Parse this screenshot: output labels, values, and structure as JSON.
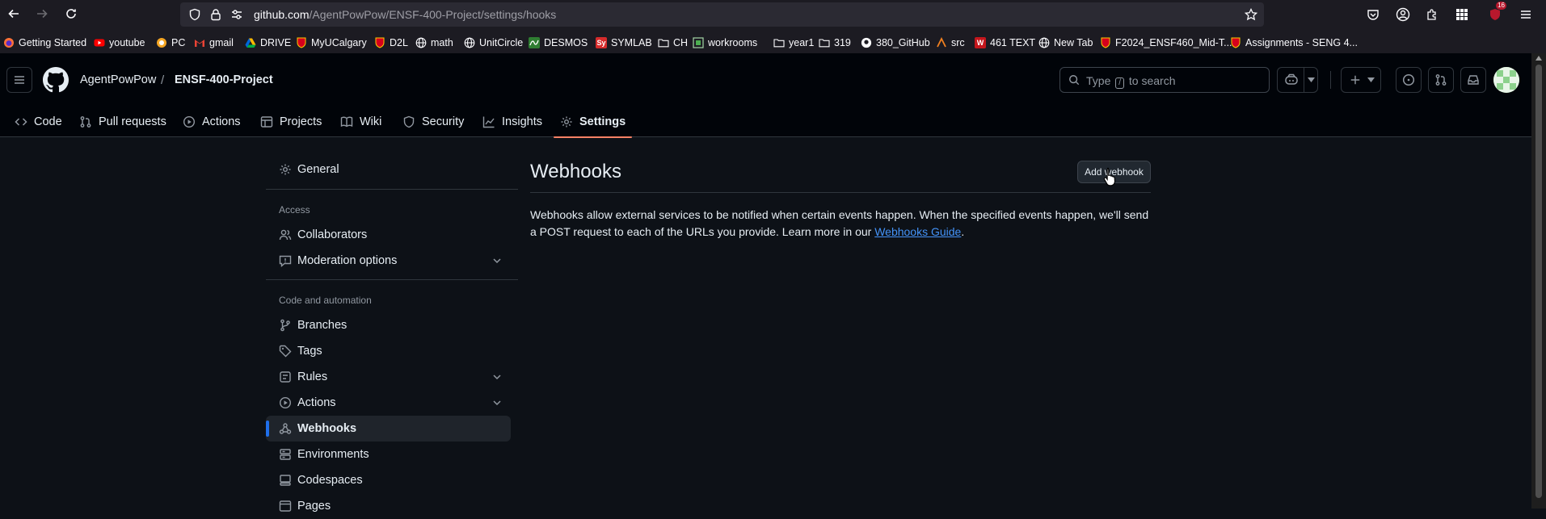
{
  "browser": {
    "url_host": "github.com",
    "url_path": "/AgentPowPow/ENSF-400-Project/settings/hooks",
    "extension_badge": "16",
    "bookmarks": [
      {
        "label": "Getting Started",
        "icon": "firefox-icon",
        "color": "#e66000"
      },
      {
        "label": "youtube",
        "icon": "youtube-icon",
        "color": "#ff0000"
      },
      {
        "label": "PC",
        "icon": "pc-icon",
        "color": "#f5a623"
      },
      {
        "label": "gmail",
        "icon": "gmail-icon",
        "color": "#ea4335"
      },
      {
        "label": "DRIVE",
        "icon": "drive-icon",
        "color": "#1fa463"
      },
      {
        "label": "MyUCalgary",
        "icon": "ucalgary-icon",
        "color": "#d6001c"
      },
      {
        "label": "D2L",
        "icon": "ucalgary-icon",
        "color": "#d6001c"
      },
      {
        "label": "math",
        "icon": "globe-icon",
        "color": "#fbfbfe"
      },
      {
        "label": "UnitCircle",
        "icon": "globe-icon",
        "color": "#fbfbfe"
      },
      {
        "label": "DESMOS",
        "icon": "desmos-icon",
        "color": "#2f7d32"
      },
      {
        "label": "SYMLAB",
        "icon": "symbolab-icon",
        "color": "#d62b2b"
      },
      {
        "label": "CH",
        "icon": "folder-icon",
        "color": "#fbfbfe"
      },
      {
        "label": "workrooms",
        "icon": "workrooms-icon",
        "color": "#4caf50"
      },
      {
        "label": "year1",
        "icon": "folder-icon",
        "color": "#fbfbfe"
      },
      {
        "label": "319",
        "icon": "folder-icon",
        "color": "#fbfbfe"
      },
      {
        "label": "380_GitHub",
        "icon": "github-icon",
        "color": "#fbfbfe"
      },
      {
        "label": "src",
        "icon": "src-icon",
        "color": "#f38020"
      },
      {
        "label": "461 TEXT",
        "icon": "w-icon",
        "color": "#c4161c"
      },
      {
        "label": "New Tab",
        "icon": "globe-icon",
        "color": "#fbfbfe"
      },
      {
        "label": "F2024_ENSF460_Mid-T...",
        "icon": "ucalgary-icon",
        "color": "#d6001c"
      },
      {
        "label": "Assignments - SENG 4...",
        "icon": "ucalgary-icon",
        "color": "#d6001c"
      }
    ]
  },
  "repo": {
    "owner": "AgentPowPow",
    "separator": "/",
    "name": "ENSF-400-Project"
  },
  "search": {
    "placeholder_before": "Type",
    "placeholder_key": "/",
    "placeholder_after": "to search"
  },
  "tabs": [
    {
      "label": "Code",
      "icon": "code-icon"
    },
    {
      "label": "Pull requests",
      "icon": "pull-request-icon"
    },
    {
      "label": "Actions",
      "icon": "play-icon"
    },
    {
      "label": "Projects",
      "icon": "table-icon"
    },
    {
      "label": "Wiki",
      "icon": "book-icon"
    },
    {
      "label": "Security",
      "icon": "shield-icon"
    },
    {
      "label": "Insights",
      "icon": "graph-icon"
    },
    {
      "label": "Settings",
      "icon": "gear-icon",
      "active": true
    }
  ],
  "sidebar": {
    "general": "General",
    "access_heading": "Access",
    "collaborators": "Collaborators",
    "moderation": "Moderation options",
    "code_heading": "Code and automation",
    "branches": "Branches",
    "tags": "Tags",
    "rules": "Rules",
    "actions": "Actions",
    "webhooks": "Webhooks",
    "environments": "Environments",
    "codespaces": "Codespaces",
    "pages": "Pages"
  },
  "main": {
    "title": "Webhooks",
    "add_button": "Add webhook",
    "description_prefix": "Webhooks allow external services to be notified when certain events happen. When the specified events happen, we'll send a POST request to each of the URLs you provide. Learn more in our",
    "link_text": "Webhooks Guide",
    "description_suffix": "."
  },
  "colors": {
    "page_bg": "#0d1117",
    "header_bg": "#010409",
    "accent_tab": "#f78166",
    "active_indicator": "#1f6feb",
    "link": "#4493f8"
  }
}
